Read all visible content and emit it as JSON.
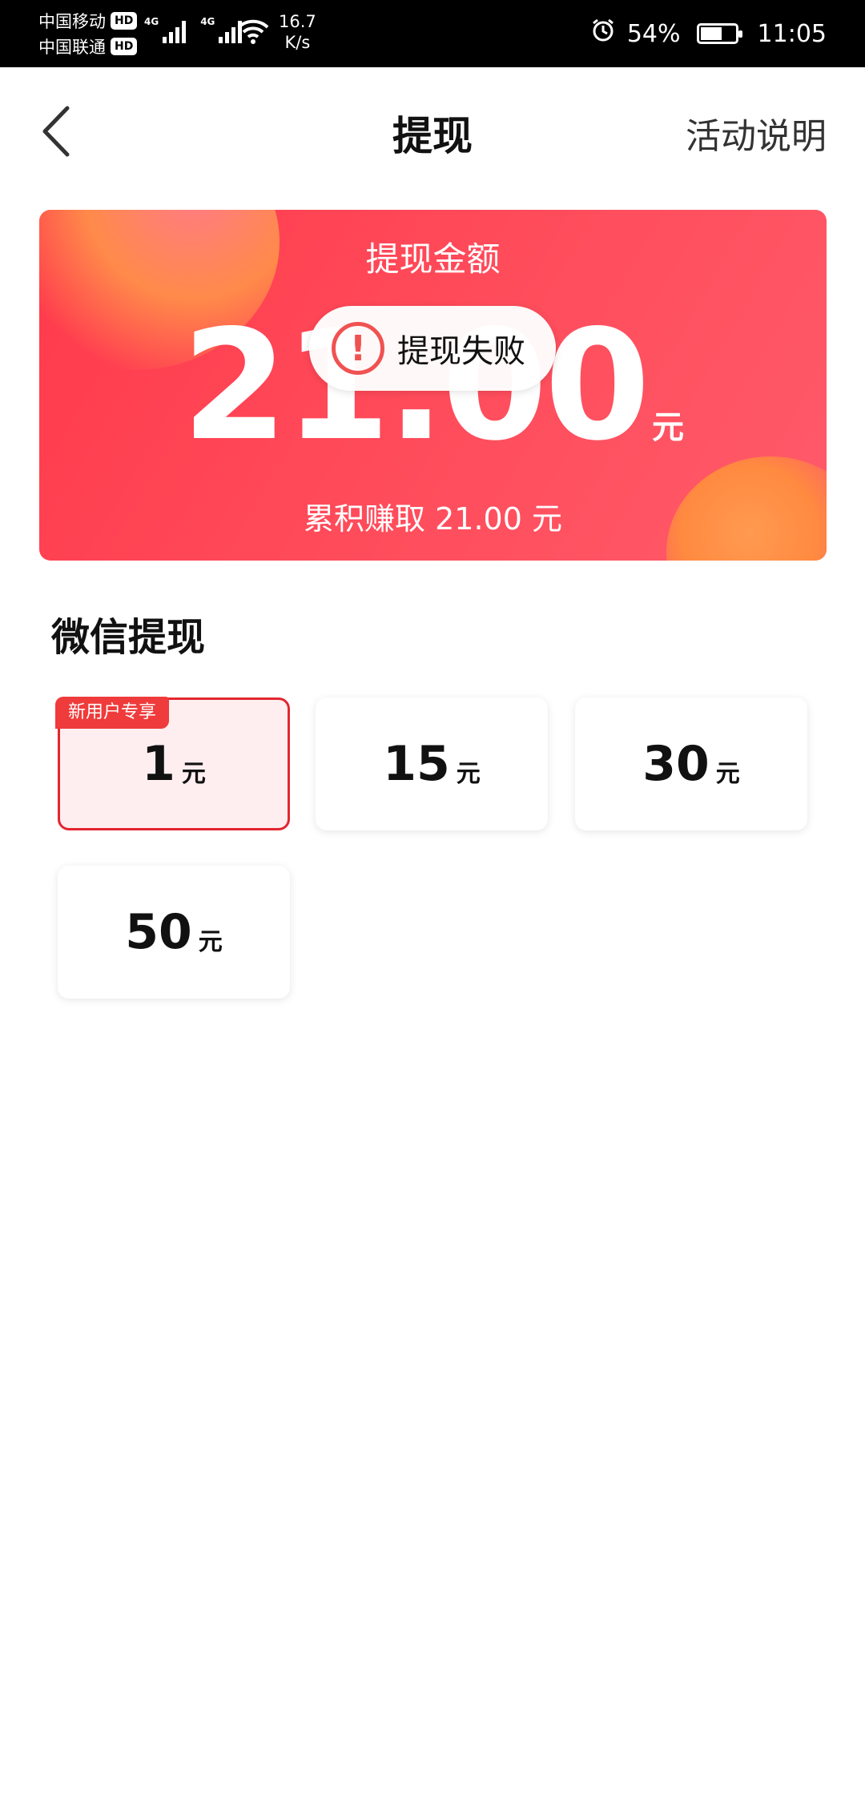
{
  "status_bar": {
    "carrier1": "中国移动",
    "carrier2": "中国联通",
    "hd": "HD",
    "net": "4G",
    "speed_value": "16.7",
    "speed_unit": "K/s",
    "battery": "54%",
    "time": "11:05"
  },
  "header": {
    "title": "提现",
    "activity_link": "活动说明"
  },
  "card": {
    "label": "提现金额",
    "amount": "21.00",
    "unit": "元",
    "earned": "累积赚取 21.00 元"
  },
  "toast": {
    "icon": "!",
    "text": "提现失败"
  },
  "section": {
    "title": "微信提现"
  },
  "options": [
    {
      "value": "1",
      "unit": "元",
      "tag": "新用户专享",
      "selected": true
    },
    {
      "value": "15",
      "unit": "元"
    },
    {
      "value": "30",
      "unit": "元"
    },
    {
      "value": "50",
      "unit": "元"
    }
  ],
  "colors": {
    "accent": "#e3262f",
    "card_bg": "#ff4d5c"
  }
}
